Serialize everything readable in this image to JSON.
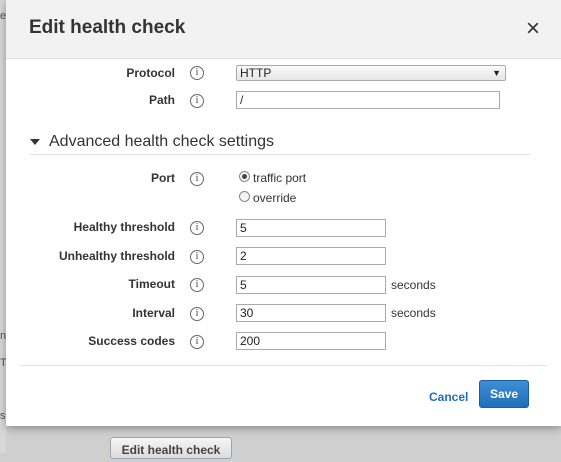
{
  "background": {
    "fragments": [
      "e",
      "n",
      "T",
      "s"
    ],
    "button_label": "Edit health check"
  },
  "modal": {
    "title": "Edit health check",
    "close_glyph": "×"
  },
  "form": {
    "protocol": {
      "label": "Protocol",
      "value": "HTTP",
      "options": [
        "HTTP"
      ]
    },
    "path": {
      "label": "Path",
      "value": "/"
    },
    "advanced": {
      "title": "Advanced health check settings",
      "port": {
        "label": "Port",
        "options": [
          {
            "label": "traffic port",
            "selected": true
          },
          {
            "label": "override",
            "selected": false
          }
        ]
      },
      "healthy_threshold": {
        "label": "Healthy threshold",
        "value": "5"
      },
      "unhealthy_threshold": {
        "label": "Unhealthy threshold",
        "value": "2"
      },
      "timeout": {
        "label": "Timeout",
        "value": "5",
        "unit": "seconds"
      },
      "interval": {
        "label": "Interval",
        "value": "30",
        "unit": "seconds"
      },
      "success_codes": {
        "label": "Success codes",
        "value": "200"
      }
    },
    "info_glyph": "i"
  },
  "footer": {
    "cancel_label": "Cancel",
    "save_label": "Save"
  },
  "colors": {
    "primary": "#1f6fb8",
    "link": "#1f6fb8",
    "header_bg": "#f2f2f2"
  }
}
